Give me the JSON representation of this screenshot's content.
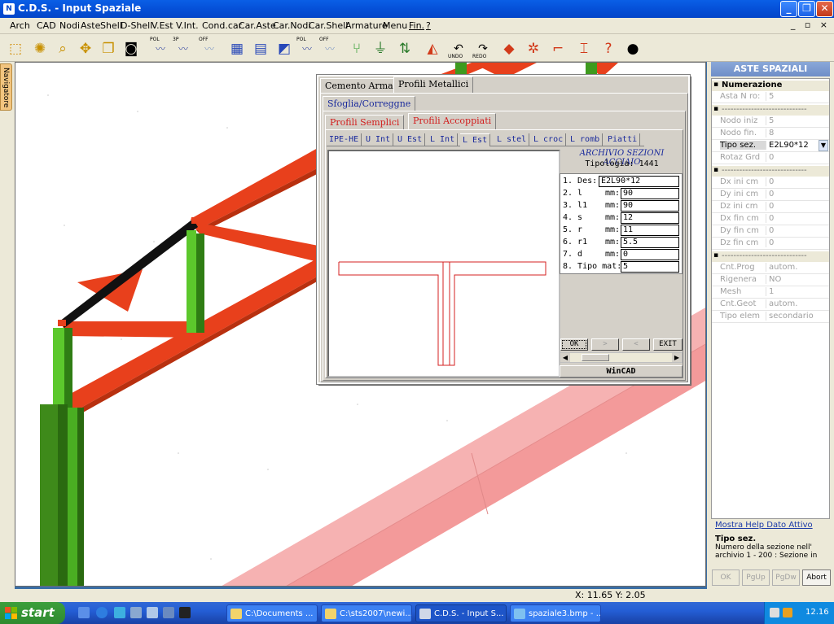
{
  "window": {
    "title": "C.D.S. - Input Spaziale",
    "minimize": "_",
    "restore": "❐",
    "close": "✕"
  },
  "menu": [
    "Arch",
    "CAD",
    "Nodi",
    "Aste",
    "Shell",
    "D-Shell",
    "V.Est",
    "V.Int.",
    "Cond.car",
    "Car.Aste",
    "Car.Nodi",
    "Car.Shell",
    "Armature",
    "Menu",
    "Fin.",
    "?"
  ],
  "mdi_controls": "_ ▫ ×",
  "toolbar": {
    "labels": {
      "pol": "POL",
      "3p": "3P",
      "off": "OFF",
      "undo": "UNDO",
      "redo": "REDO"
    }
  },
  "navigator": {
    "label": "Navigatore"
  },
  "dialog": {
    "tabs_top": [
      "Cemento Armato",
      "Profili Metallici"
    ],
    "tab_sfoglia": "Sfoglia/Correggne",
    "tabs_profili": [
      "Profili Semplici",
      "Profili Accoppiati"
    ],
    "subtabs": [
      "IPE-HE",
      "U Int",
      "U Est",
      "L Int",
      "L Est",
      "L stel",
      "L croc",
      "L romb",
      "Piatti"
    ],
    "archive_title": "ARCHIVIO SEZIONI ACCIAIO",
    "tipologia": "Tipologia: 1441",
    "fields": [
      {
        "label": "1. Des:",
        "unit": "",
        "value": "E2L90*12"
      },
      {
        "label": "2. l",
        "unit": "mm:",
        "value": "90"
      },
      {
        "label": "3. l1",
        "unit": "mm:",
        "value": "90"
      },
      {
        "label": "4. s",
        "unit": "mm:",
        "value": "12"
      },
      {
        "label": "5. r",
        "unit": "mm:",
        "value": "11"
      },
      {
        "label": "6. r1",
        "unit": "mm:",
        "value": "5.5"
      },
      {
        "label": "7. d",
        "unit": "mm:",
        "value": "0"
      },
      {
        "label": "8. Tipo mat:",
        "unit": "",
        "value": "5"
      }
    ],
    "buttons": {
      "ok": "OK",
      "next": ">",
      "prev": "<",
      "exit": "EXIT"
    },
    "footer": "WinCAD"
  },
  "right_panel": {
    "title": "ASTE SPAZIALI",
    "sections": [
      {
        "title": "Numerazione",
        "rows": [
          {
            "k": "Asta N ro:",
            "v": "5"
          }
        ]
      },
      {
        "title": "-----------------------------",
        "rows": [
          {
            "k": "Nodo iniz",
            "v": "5"
          },
          {
            "k": "Nodo fin.",
            "v": "8"
          },
          {
            "k": "Tipo sez.",
            "v": "E2L90*12"
          },
          {
            "k": "Rotaz Grd",
            "v": "0"
          }
        ]
      },
      {
        "title": "-----------------------------",
        "rows": [
          {
            "k": "Dx ini cm",
            "v": "0"
          },
          {
            "k": "Dy ini cm",
            "v": "0"
          },
          {
            "k": "Dz ini cm",
            "v": "0"
          },
          {
            "k": "Dx fin cm",
            "v": "0"
          },
          {
            "k": "Dy fin cm",
            "v": "0"
          },
          {
            "k": "Dz fin cm",
            "v": "0"
          }
        ]
      },
      {
        "title": "-----------------------------",
        "rows": [
          {
            "k": "Cnt.Prog",
            "v": "autom."
          },
          {
            "k": "Rigenera",
            "v": "NO"
          },
          {
            "k": "Mesh",
            "v": "1"
          },
          {
            "k": "Cnt.Geot",
            "v": "autom."
          },
          {
            "k": "Tipo elem",
            "v": "secondario"
          }
        ]
      }
    ],
    "help_link": "Mostra Help Dato Attivo",
    "info_title": "Tipo sez.",
    "info_text_1": "Numero della sezione nell'",
    "info_text_2": "archivio   1 - 200  : Sezione in",
    "buttons": [
      "OK",
      "PgUp",
      "PgDw",
      "Abort"
    ]
  },
  "status": {
    "coords": "X: 11.65  Y:  2.05"
  },
  "taskbar": {
    "start": "start",
    "tasks": [
      "C:\\Documents ...",
      "C:\\sts2007\\newi...",
      "C.D.S. - Input S...",
      "spaziale3.bmp - ..."
    ],
    "clock": "12.16"
  },
  "colors": {
    "beam": "#e8401c",
    "pink": "#f4a0a0",
    "column": "#3e9a1e",
    "selected": "#000000",
    "section": "#d42020"
  }
}
